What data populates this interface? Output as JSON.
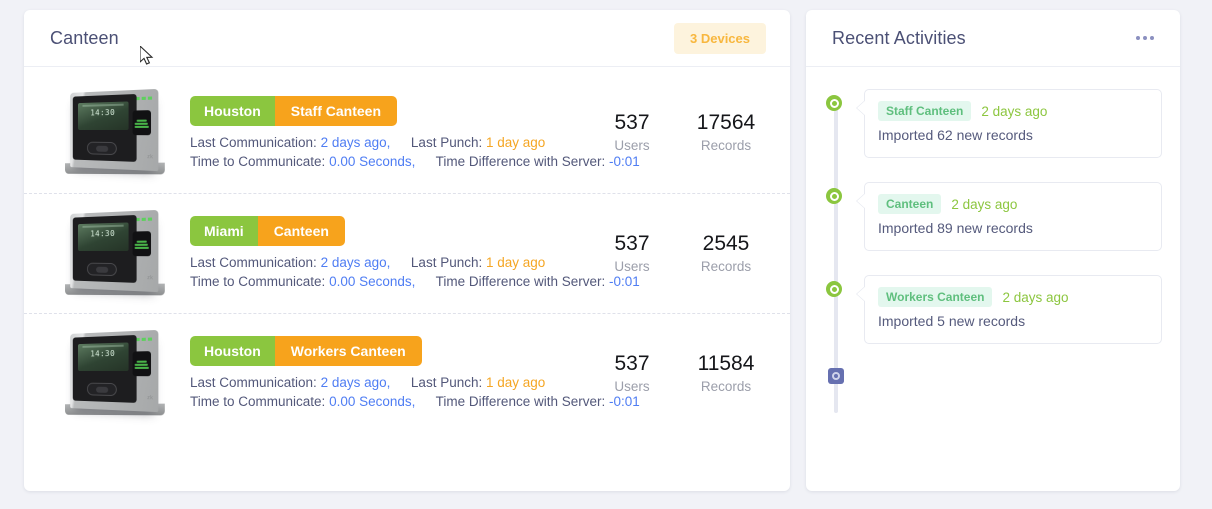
{
  "devices_panel": {
    "title": "Canteen",
    "badge": "3 Devices",
    "rows": [
      {
        "location": "Houston",
        "name": "Staff Canteen",
        "last_communication_label": "Last Communication:",
        "last_communication_value": "2 days ago,",
        "last_punch_label": "Last Punch:",
        "last_punch_value": "1 day ago",
        "time_to_communicate_label": "Time to Communicate:",
        "time_to_communicate_value": "0.00 Seconds,",
        "time_difference_label": "Time Difference with Server:",
        "time_difference_value": "-0:01",
        "users_value": "537",
        "users_label": "Users",
        "records_value": "17564",
        "records_label": "Records",
        "device_clock": "14:30"
      },
      {
        "location": "Miami",
        "name": "Canteen",
        "last_communication_label": "Last Communication:",
        "last_communication_value": "2 days ago,",
        "last_punch_label": "Last Punch:",
        "last_punch_value": "1 day ago",
        "time_to_communicate_label": "Time to Communicate:",
        "time_to_communicate_value": "0.00 Seconds,",
        "time_difference_label": "Time Difference with Server:",
        "time_difference_value": "-0:01",
        "users_value": "537",
        "users_label": "Users",
        "records_value": "2545",
        "records_label": "Records",
        "device_clock": "14:30"
      },
      {
        "location": "Houston",
        "name": "Workers Canteen",
        "last_communication_label": "Last Communication:",
        "last_communication_value": "2 days ago,",
        "last_punch_label": "Last Punch:",
        "last_punch_value": "1 day ago",
        "time_to_communicate_label": "Time to Communicate:",
        "time_to_communicate_value": "0.00 Seconds,",
        "time_difference_label": "Time Difference with Server:",
        "time_difference_value": "-0:01",
        "users_value": "537",
        "users_label": "Users",
        "records_value": "11584",
        "records_label": "Records",
        "device_clock": "14:30"
      }
    ]
  },
  "activities_panel": {
    "title": "Recent Activities",
    "menu_icon": "more-horizontal-icon",
    "items": [
      {
        "tag": "Staff Canteen",
        "time": "2 days ago",
        "text": "Imported 62 new records"
      },
      {
        "tag": "Canteen",
        "time": "2 days ago",
        "text": "Imported 89 new records"
      },
      {
        "tag": "Workers Canteen",
        "time": "2 days ago",
        "text": "Imported 5 new records"
      }
    ]
  },
  "colors": {
    "page_background": "#f1f2f7",
    "location_tag": "#8bc63f",
    "name_tag": "#f7a31c",
    "badge_background": "#fdf3dd",
    "badge_text": "#f8b73e",
    "value_blue": "#4f7df3",
    "value_orange": "#f5a623",
    "timeline_dot": "#8bc63f",
    "timeline_end": "#6670b0",
    "chip_background": "#e3f7ee",
    "chip_text": "#5fbf7e"
  }
}
